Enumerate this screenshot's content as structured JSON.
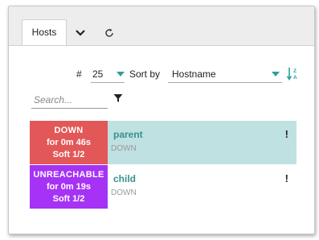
{
  "tabs": {
    "hosts_label": "Hosts",
    "dropdown_icon": "chevron-down-icon",
    "refresh_icon": "refresh-icon"
  },
  "controls": {
    "count_symbol": "#",
    "per_page_value": "25",
    "sort_by_label": "Sort by",
    "sort_field_value": "Hostname",
    "sort_direction_icon": "sort-alpha-icon",
    "search_placeholder": "Search...",
    "filter_icon": "filter-icon",
    "accent_color": "#2aa198"
  },
  "hosts": [
    {
      "name": "parent",
      "state": "DOWN",
      "status_label": "DOWN",
      "duration": "for 0m 46s",
      "attempt": "Soft 1/2",
      "flag": "!",
      "status_color": "#e25757",
      "row_color": "#c0e1e1"
    },
    {
      "name": "child",
      "state": "DOWN",
      "status_label": "UNREACHABLE",
      "duration": "for 0m 19s",
      "attempt": "Soft 1/2",
      "flag": "!",
      "status_color": "#a532f5",
      "row_color": "#ffffff"
    }
  ]
}
